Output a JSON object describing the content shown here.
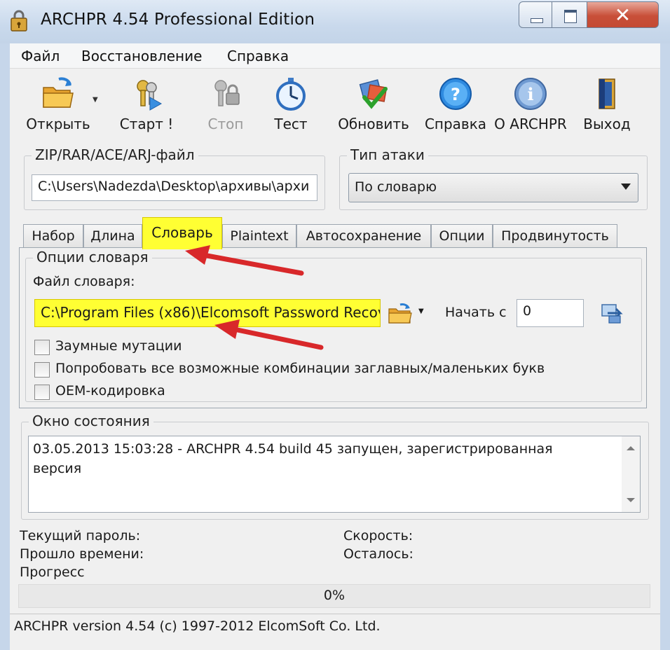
{
  "window": {
    "title": "ARCHPR 4.54 Professional Edition",
    "close_glyph": "✕"
  },
  "menu": [
    "Файл",
    "Восстановление",
    "Справка"
  ],
  "toolbar": [
    {
      "label": "Открыть",
      "icon": "open-folder-icon"
    },
    {
      "label": "Старт !",
      "icon": "start-keys-icon"
    },
    {
      "label": "Стоп",
      "icon": "stop-lock-icon",
      "disabled": true
    },
    {
      "label": "Тест",
      "icon": "stopwatch-icon"
    },
    {
      "label": "Обновить",
      "icon": "update-check-icon"
    },
    {
      "label": "Справка",
      "icon": "help-icon"
    },
    {
      "label": "О ARCHPR",
      "icon": "info-icon"
    },
    {
      "label": "Выход",
      "icon": "exit-door-icon"
    }
  ],
  "file_group": {
    "title": "ZIP/RAR/ACE/ARJ-файл",
    "path": "C:\\Users\\Nadezda\\Desktop\\архивы\\архи"
  },
  "attack_group": {
    "title": "Тип атаки",
    "selected": "По словарю"
  },
  "tabs": [
    "Набор",
    "Длина",
    "Словарь",
    "Plaintext",
    "Автосохранение",
    "Опции",
    "Продвинутость"
  ],
  "active_tab_index": 2,
  "dictionary": {
    "group_title": "Опции словаря",
    "file_label": "Файл словаря:",
    "file_path": "C:\\Program Files (x86)\\Elcomsoft Password Recov",
    "start_label": "Начать с",
    "start_value": "0",
    "options": [
      {
        "label": "Заумные мутации",
        "checked": false
      },
      {
        "label": "Попробовать все возможные комбинации заглавных/маленьких букв",
        "checked": false
      },
      {
        "label": "OEM-кодировка",
        "checked": false
      }
    ]
  },
  "status": {
    "title": "Окно состояния",
    "log_line1": "03.05.2013 15:03:28 - ARCHPR 4.54 build 45 запущен, зарегистрированная",
    "log_line2": "версия"
  },
  "info": {
    "current_password": "Текущий пароль:",
    "elapsed": "Прошло времени:",
    "progress": "Прогресс",
    "speed": "Скорость:",
    "remaining": "Осталось:"
  },
  "progress": {
    "value": 0,
    "text": "0%"
  },
  "statusbar": "ARCHPR version 4.54 (c) 1997-2012 ElcomSoft Co. Ltd.",
  "colors": {
    "highlight": "#ffff33",
    "annotation_arrow": "#d8282a",
    "progress_fill": "#06b025"
  }
}
